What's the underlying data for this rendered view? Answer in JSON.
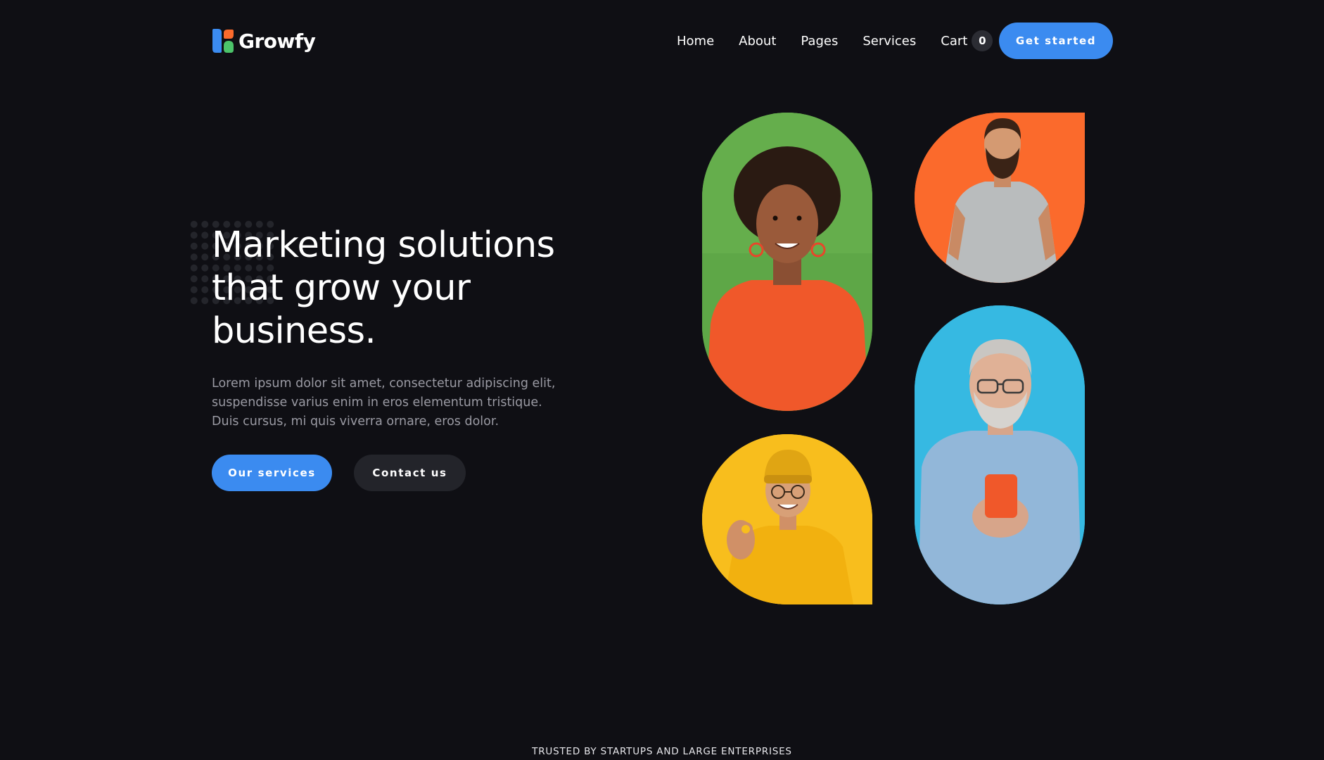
{
  "brand": {
    "name": "Growfy",
    "colors": {
      "blue": "#3b8bf0",
      "orange": "#fb6a2c",
      "green": "#4cc46a"
    }
  },
  "nav": {
    "items": [
      "Home",
      "About",
      "Pages",
      "Services"
    ],
    "cart_label": "Cart",
    "cart_count": "0"
  },
  "header": {
    "cta_label": "Get started"
  },
  "hero": {
    "title_lines": [
      "Marketing solutions",
      "that grow your",
      "business."
    ],
    "paragraph_lines": [
      "Lorem ipsum dolor sit amet, consectetur adipiscing elit,",
      "suspendisse varius enim in eros elementum tristique.",
      "Duis cursus, mi quis viverra ornare, eros dolor."
    ],
    "primary_button": "Our services",
    "secondary_button": "Contact us"
  },
  "photos": [
    {
      "name": "woman-green-background-photo",
      "bg": "#5ea747"
    },
    {
      "name": "bearded-man-orange-background-photo",
      "bg": "#fb6a2c"
    },
    {
      "name": "man-yellow-background-photo",
      "bg": "#f8be1d"
    },
    {
      "name": "older-man-blue-background-photo",
      "bg": "#36b9e2"
    }
  ],
  "trusted_label": "TRUSTED BY STARTUPS AND LARGE ENTERPRISES",
  "theme": {
    "background": "#0f0f14",
    "muted_text": "#9a9aa3",
    "dark_button": "#23242a"
  }
}
